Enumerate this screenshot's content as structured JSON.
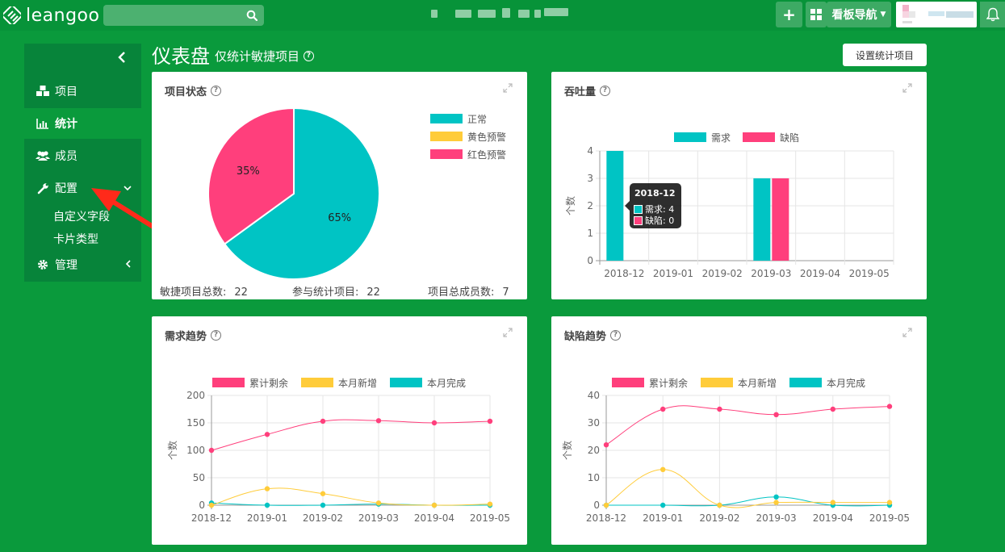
{
  "topbar": {
    "logo_text": "leangoo",
    "board_nav_label": "看板导航"
  },
  "sidebar": {
    "items": [
      {
        "label": "项目"
      },
      {
        "label": "统计"
      },
      {
        "label": "成员"
      },
      {
        "label": "配置"
      },
      {
        "label": "管理"
      }
    ],
    "sub_items": [
      "自定义字段",
      "卡片类型"
    ]
  },
  "page": {
    "title": "仪表盘",
    "subtitle": "仅统计敏捷项目",
    "settings_button": "设置统计项目"
  },
  "colors": {
    "teal": "#00c4c4",
    "pink": "#ff3f7c",
    "yellow": "#ffcc3a",
    "green_bg": "#0a9a3c"
  },
  "project_status": {
    "title": "项目状态",
    "stats": [
      {
        "label": "敏捷项目总数:",
        "value": "22"
      },
      {
        "label": "参与统计项目:",
        "value": "22"
      },
      {
        "label": "项目总成员数:",
        "value": "7"
      }
    ],
    "chart_data": {
      "type": "pie",
      "slices": [
        {
          "label": "正常",
          "value": 65,
          "color": "#00c4c4",
          "text": "65%"
        },
        {
          "label": "黄色预警",
          "value": 0,
          "color": "#ffcc3a",
          "text": ""
        },
        {
          "label": "红色预警",
          "value": 35,
          "color": "#ff3f7c",
          "text": "35%"
        }
      ],
      "legend": "top-right"
    }
  },
  "throughput": {
    "title": "吞吐量",
    "tooltip": {
      "title": "2018-12",
      "lines": [
        "需求: 4",
        "缺陷: 0"
      ]
    },
    "chart_data": {
      "type": "bar",
      "categories": [
        "2018-12",
        "2019-01",
        "2019-02",
        "2019-03",
        "2019-04",
        "2019-05"
      ],
      "series": [
        {
          "name": "需求",
          "values": [
            4,
            0,
            0,
            3,
            0,
            0
          ],
          "color": "#00c4c4"
        },
        {
          "name": "缺陷",
          "values": [
            0,
            0,
            0,
            3,
            0,
            0
          ],
          "color": "#ff3f7c"
        }
      ],
      "ylabel": "个数",
      "ylim": [
        0,
        4
      ],
      "yticks": [
        0,
        1,
        2,
        3,
        4
      ],
      "grid": true,
      "legend": "top"
    }
  },
  "demand_trend": {
    "title": "需求趋势",
    "chart_data": {
      "type": "line",
      "categories": [
        "2018-12",
        "2019-01",
        "2019-02",
        "2019-03",
        "2019-04",
        "2019-05"
      ],
      "series": [
        {
          "name": "累计剩余",
          "values": [
            100,
            129,
            153,
            154,
            150,
            153
          ],
          "color": "#ff3f7c"
        },
        {
          "name": "本月新增",
          "values": [
            0,
            30,
            21,
            4,
            0,
            2
          ],
          "color": "#ffcc3a"
        },
        {
          "name": "本月完成",
          "values": [
            4,
            0,
            0,
            2,
            0,
            0
          ],
          "color": "#00c4c4"
        }
      ],
      "ylabel": "个数",
      "ylim": [
        0,
        200
      ],
      "yticks": [
        0,
        50,
        100,
        150,
        200
      ],
      "grid": true,
      "legend": "top"
    }
  },
  "defect_trend": {
    "title": "缺陷趋势",
    "chart_data": {
      "type": "line",
      "categories": [
        "2018-12",
        "2019-01",
        "2019-02",
        "2019-03",
        "2019-04",
        "2019-05"
      ],
      "series": [
        {
          "name": "累计剩余",
          "values": [
            22,
            35,
            35,
            33,
            35,
            36
          ],
          "color": "#ff3f7c"
        },
        {
          "name": "本月新增",
          "values": [
            0,
            13,
            0,
            1,
            1,
            1
          ],
          "color": "#ffcc3a"
        },
        {
          "name": "本月完成",
          "values": [
            0,
            0,
            0,
            3,
            0,
            0
          ],
          "color": "#00c4c4"
        }
      ],
      "ylabel": "个数",
      "ylim": [
        0,
        40
      ],
      "yticks": [
        0,
        10,
        20,
        30,
        40
      ],
      "grid": true,
      "legend": "top"
    }
  }
}
